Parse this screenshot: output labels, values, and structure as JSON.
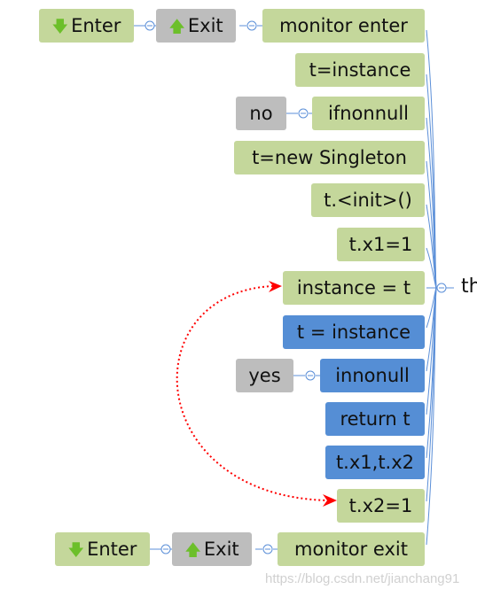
{
  "root": {
    "label": "th"
  },
  "colors": {
    "green": "#c4d79b",
    "gray": "#bdbdbd",
    "blue": "#558ed5",
    "connector": "#5b8fd8",
    "arrow": "#ff0000"
  },
  "top_row": {
    "enter": "Enter",
    "exit": "Exit",
    "node": "monitor enter"
  },
  "nodes": [
    {
      "label": "t=instance",
      "color": "green"
    },
    {
      "label": "ifnonnull",
      "color": "green",
      "child": "no"
    },
    {
      "label": "t=new Singleton",
      "color": "green"
    },
    {
      "label": "t.<init>()",
      "color": "green"
    },
    {
      "label": "t.x1=1",
      "color": "green"
    },
    {
      "label": "instance = t",
      "color": "green"
    },
    {
      "label": "t = instance",
      "color": "blue"
    },
    {
      "label": "innonull",
      "color": "blue",
      "child": "yes"
    },
    {
      "label": "return t",
      "color": "blue"
    },
    {
      "label": "t.x1,t.x2",
      "color": "blue"
    },
    {
      "label": "t.x2=1",
      "color": "green"
    }
  ],
  "bottom_row": {
    "enter": "Enter",
    "exit": "Exit",
    "node": "monitor exit"
  },
  "watermark": "https://blog.csdn.net/jianchang91"
}
